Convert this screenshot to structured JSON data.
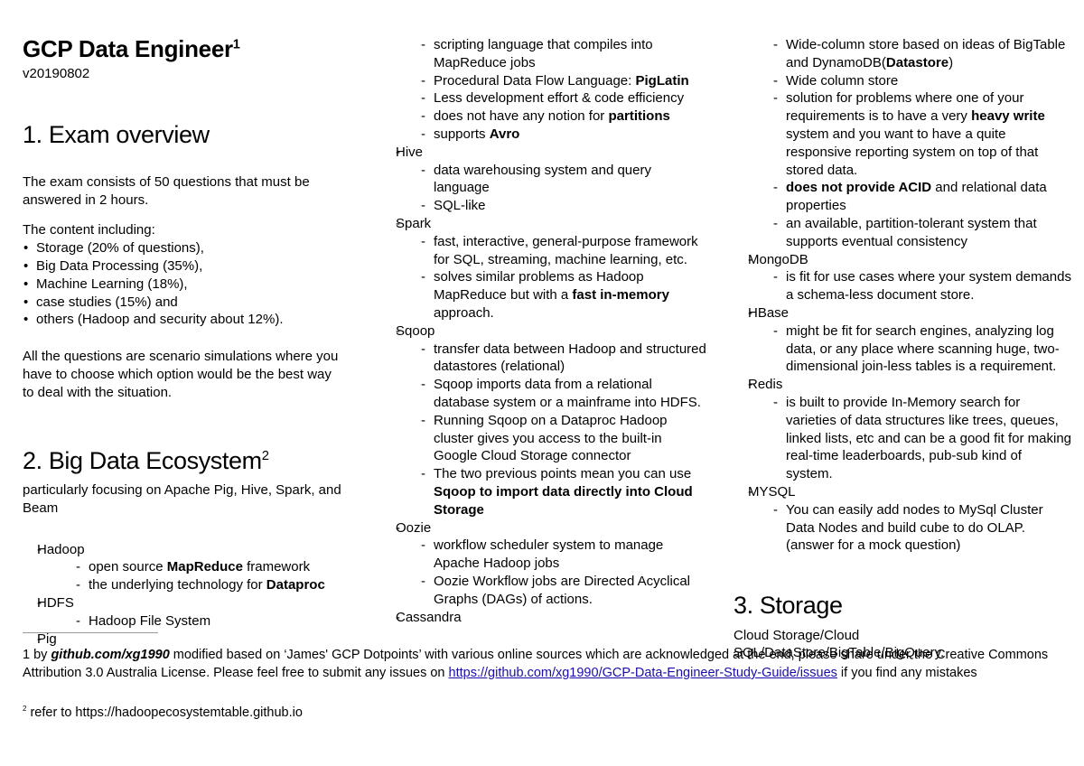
{
  "document": {
    "title": "GCP Data Engineer",
    "title_superscript": "1",
    "version": "v20190802"
  },
  "sections": {
    "exam_overview": {
      "heading": "1. Exam overview",
      "intro": "The exam consists of 50 questions that must be answered in 2 hours.",
      "content_label": "The content including:",
      "content_items": [
        "Storage (20% of questions),",
        "Big Data Processing (35%),",
        "Machine Learning (18%),",
        "case studies (15%) and",
        "others (Hadoop and security about 12%)."
      ],
      "outro": "All the questions are scenario simulations where you have to choose which option would be the best way to deal with the situation."
    },
    "big_data_ecosystem": {
      "heading": "2. Big Data Ecosystem",
      "heading_superscript": "2",
      "subtitle": "particularly focusing on Apache Pig, Hive, Spark, and Beam"
    },
    "storage": {
      "heading": "3. Storage",
      "body": "Cloud Storage/Cloud SQL/DataStore/BigTable/BigQuery."
    }
  },
  "column_left_items": [
    {
      "level": 1,
      "text": "Hadoop"
    },
    {
      "level": 2,
      "html": "open source <b>MapReduce</b> framework"
    },
    {
      "level": 2,
      "html": "the underlying technology for <b>Dataproc</b>"
    },
    {
      "level": 1,
      "text": "HDFS"
    },
    {
      "level": 2,
      "text": "Hadoop File System"
    },
    {
      "level": 1,
      "text": "Pig"
    }
  ],
  "column_mid_items": [
    {
      "level": 2,
      "text": "scripting language that compiles into MapReduce jobs"
    },
    {
      "level": 2,
      "html": "Procedural Data Flow Language: <b>PigLatin</b>"
    },
    {
      "level": 2,
      "text": "Less development effort & code efficiency"
    },
    {
      "level": 2,
      "html": "does not have any notion for <b>partitions</b>"
    },
    {
      "level": 2,
      "html": "supports <b>Avro</b>"
    },
    {
      "level": 1,
      "text": "Hive"
    },
    {
      "level": 2,
      "text": "data warehousing system and query language"
    },
    {
      "level": 2,
      "text": "SQL-like"
    },
    {
      "level": 1,
      "text": "Spark"
    },
    {
      "level": 2,
      "text": "fast, interactive, general-purpose framework for SQL, streaming, machine learning, etc."
    },
    {
      "level": 2,
      "html": "solves similar problems as Hadoop MapReduce but with a <b>fast in-memory</b> approach."
    },
    {
      "level": 1,
      "text": "Sqoop"
    },
    {
      "level": 2,
      "text": "transfer data between Hadoop and structured datastores (relational)"
    },
    {
      "level": 2,
      "text": "Sqoop imports data from a relational database system or a mainframe into HDFS."
    },
    {
      "level": 2,
      "text": "Running Sqoop on a Dataproc Hadoop cluster gives you access to the built-in Google Cloud Storage connector"
    },
    {
      "level": 2,
      "html": "The two previous points mean you can use <b>Sqoop to import data directly into Cloud Storage</b>"
    },
    {
      "level": 1,
      "text": "Oozie"
    },
    {
      "level": 2,
      "text": "workflow scheduler system to manage Apache Hadoop jobs"
    },
    {
      "level": 2,
      "text": "Oozie Workflow jobs are Directed Acyclical Graphs (DAGs) of actions."
    },
    {
      "level": 1,
      "text": "Cassandra"
    }
  ],
  "column_right_items": [
    {
      "level": 2,
      "html": "Wide-column store based on ideas of BigTable and DynamoDB(<b>Datastore</b>)"
    },
    {
      "level": 2,
      "text": "Wide column store"
    },
    {
      "level": 2,
      "html": "solution for problems where one of your requirements is to have a very <b>heavy write</b> system and you want to have a quite responsive reporting system on top of that stored data."
    },
    {
      "level": 2,
      "html": "<b>does not provide ACID</b> and relational data properties"
    },
    {
      "level": 2,
      "text": "an available, partition-tolerant system that supports eventual consistency"
    },
    {
      "level": 1,
      "text": "MongoDB"
    },
    {
      "level": 2,
      "text": "is fit for use cases where your system demands a schema-less document store."
    },
    {
      "level": 1,
      "text": "HBase"
    },
    {
      "level": 2,
      "text": "might be fit for search engines, analyzing log data, or any place where scanning huge, two-dimensional join-less tables is a requirement."
    },
    {
      "level": 1,
      "text": "Redis"
    },
    {
      "level": 2,
      "text": "is built to provide In-Memory search for varieties of data structures like trees, queues, linked lists, etc and can be a good fit for making real-time leaderboards, pub-sub kind of system."
    },
    {
      "level": 1,
      "text": "MYSQL"
    },
    {
      "level": 2,
      "text": "You can easily add nodes to MySql Cluster Data Nodes and build cube to do OLAP. (answer for a mock question)"
    }
  ],
  "footnotes": {
    "note1_html": "1 by <b><i>github.com/xg1990</i></b> modified based on ‘James' GCP Dotpoints’ with various online sources which are acknowledged at the end, please share under the Creative Commons Attribution 3.0 Australia License. Please feel free to submit any issues on <a class=\"link\" href=\"#\" data-name=\"issues-link\" data-interactable=\"true\">https://github.com/xg1990/GCP-Data-Engineer-Study-Guide/issues</a> if you find any mistakes",
    "note2_prefix": "2",
    "note2_text": "refer to https://hadoopecosystemtable.github.io"
  },
  "colors": {
    "text": "#000000",
    "link": "#1a0dab",
    "rule": "#999999",
    "background": "#ffffff"
  }
}
